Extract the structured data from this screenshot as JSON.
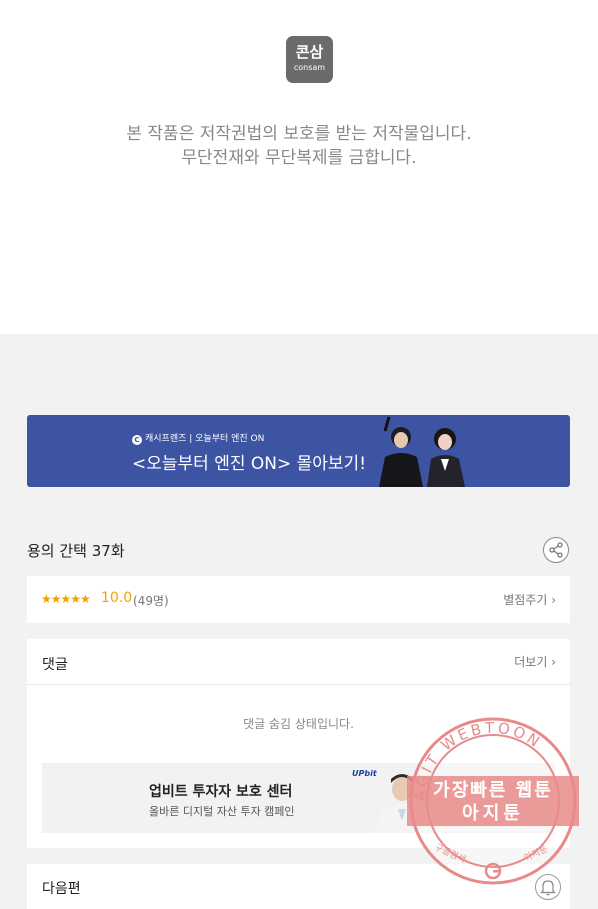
{
  "logo": {
    "korean": "콘삼",
    "english": "consam"
  },
  "copyright": {
    "line1": "본 작품은 저작권법의 보호를 받는 저작물입니다.",
    "line2": "무단전재와 무단복제를 금합니다."
  },
  "banner": {
    "channel": "캐시프렌즈 | 오늘부터 엔진 ON",
    "headline": "<오늘부터 엔진 ON> 몰아보기!",
    "background": "#3d54a3"
  },
  "episode": {
    "title": "용의 간택 37화"
  },
  "rating": {
    "stars": "★★★★★",
    "score": "10.0",
    "count": "(49명)",
    "give_label": "별점주기",
    "accent": "#f5a200"
  },
  "comments": {
    "header": "댓글",
    "more_label": "더보기",
    "hidden_notice": "댓글 숨김 상태입니다."
  },
  "ad": {
    "title": "업비트 투자자 보호 센터",
    "subtitle": "올바른 디지털 자산 투자 캠페인",
    "brand": "UPbit"
  },
  "next": {
    "label": "다음편"
  },
  "watermark": {
    "ring_text": "AGIT WEBTOON",
    "line1": "가장빠른 웹툰",
    "line2": "아지툰",
    "bottom_left": "구글검색",
    "bottom_right": "아지툰",
    "color": "#e98a8a"
  }
}
